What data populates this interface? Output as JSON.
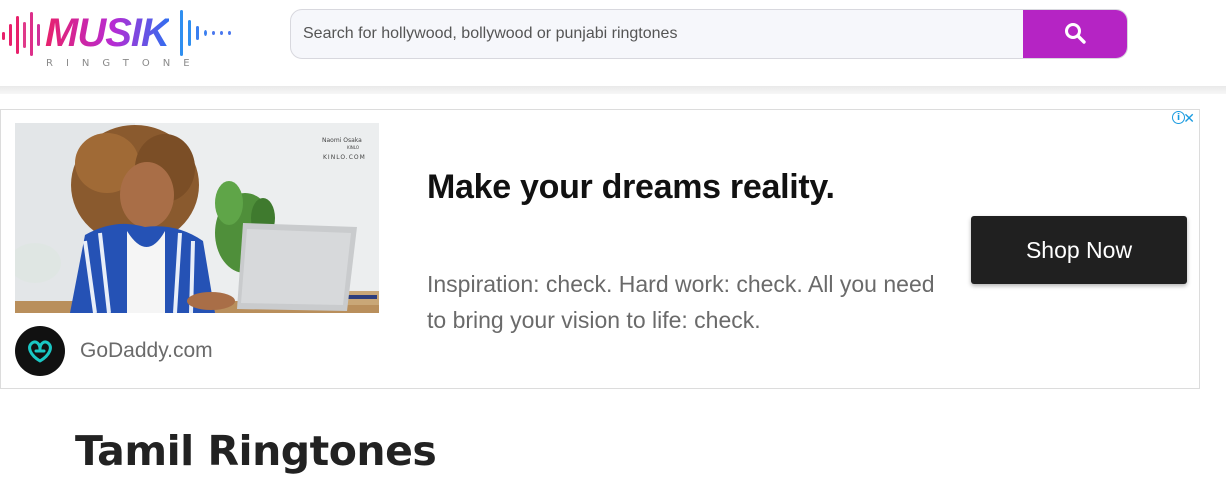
{
  "header": {
    "logo_text": "MUSIK",
    "logo_subtext": "RINGTONE",
    "search_placeholder": "Search for hollywood, bollywood or punjabi ringtones",
    "search_icon": "search-icon",
    "colors": {
      "search_button": "#b524c4",
      "logo_pink": "#e8216b",
      "logo_blue": "#2f6ff0"
    }
  },
  "ad": {
    "photo_caption_line1": "Naomi Osaka",
    "photo_caption_line2": "KINLO",
    "photo_caption_line3": "KINLO.COM",
    "headline": "Make your dreams reality.",
    "body": "Inspiration: check. Hard work: check. All you need to bring your vision to life: check.",
    "cta_label": "Shop Now",
    "advertiser": "GoDaddy.com",
    "choices_icon": "info-icon",
    "close_label": "✕"
  },
  "main": {
    "page_title": "Tamil Ringtones"
  }
}
